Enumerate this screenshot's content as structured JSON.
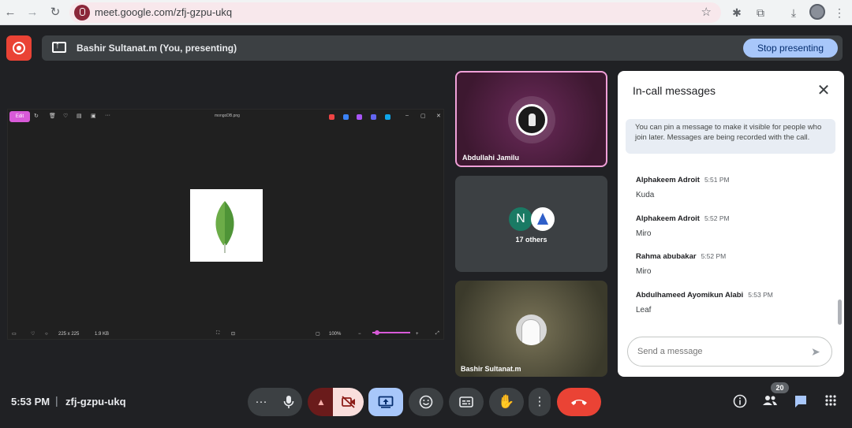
{
  "browser": {
    "url": "meet.google.com/zfj-gzpu-ukq"
  },
  "presenting": {
    "banner_text": "Bashir Sultanat.m (You, presenting)",
    "stop_label": "Stop presenting"
  },
  "shared_screen": {
    "edit_label": "Edit",
    "file_name": "mongoDB.png",
    "dims": "225 x 225",
    "size": "1.9 KB",
    "zoom": "100%"
  },
  "tiles": [
    {
      "name": "Abdullahi Jamilu"
    },
    {
      "initial": "N",
      "others_label": "17 others"
    },
    {
      "name": "Bashir Sultanat.m"
    }
  ],
  "chat": {
    "title": "In-call messages",
    "pin_note": "You can pin a message to make it visible for people who join later. Messages are being recorded with the call.",
    "messages": [
      {
        "sender": "Alphakeem Adroit",
        "time": "5:51 PM",
        "text": "Kuda"
      },
      {
        "sender": "Alphakeem Adroit",
        "time": "5:52 PM",
        "text": "Miro"
      },
      {
        "sender": "Rahma abubakar",
        "time": "5:52 PM",
        "text": "Miro"
      },
      {
        "sender": "Abdulhameed Ayomikun Alabi",
        "time": "5:53 PM",
        "text": "Leaf"
      }
    ],
    "input_placeholder": "Send a message"
  },
  "meeting": {
    "time": "5:53 PM",
    "code": "zfj-gzpu-ukq",
    "participant_count": "20"
  },
  "icons": {
    "back": "arrow-left-icon",
    "forward": "arrow-right-icon",
    "reload": "reload-icon",
    "bookmark": "star-icon",
    "extensions": "puzzle-icon",
    "download": "download-icon",
    "info": "info-icon",
    "people": "people-icon",
    "chat": "chat-icon",
    "activities": "apps-grid-icon"
  },
  "colors": {
    "accent": "#a8c7fa",
    "record": "#ea4335",
    "leave": "#ea4335",
    "edit_chip": "#d85ad8",
    "active_tile_border": "#f0a0d8"
  }
}
